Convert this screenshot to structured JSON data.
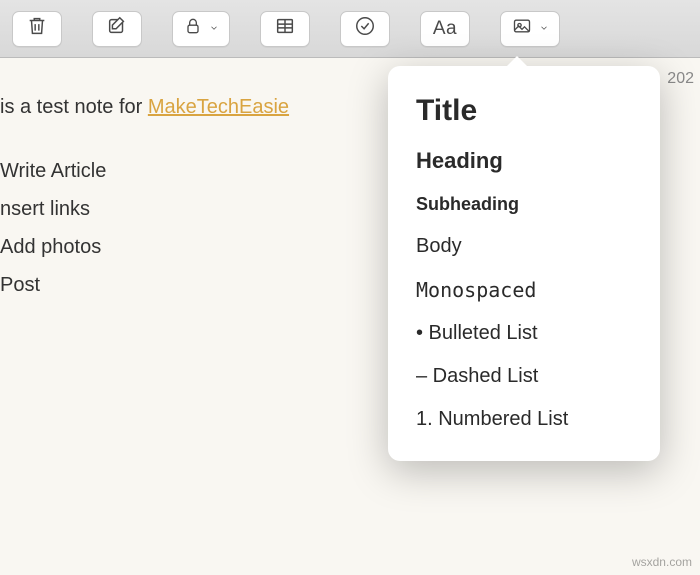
{
  "toolbar": {
    "format_label": "Aa"
  },
  "timestamp": "202",
  "note": {
    "intro_prefix": "is a test note for ",
    "intro_link": "MakeTechEasie",
    "items": [
      "Write Article",
      "nsert links",
      "Add photos",
      "Post"
    ]
  },
  "dropdown": {
    "title": "Title",
    "heading": "Heading",
    "subheading": "Subheading",
    "body": "Body",
    "monospaced": "Monospaced",
    "bulleted": "• Bulleted List",
    "dashed": "– Dashed List",
    "numbered": "1. Numbered List"
  },
  "watermark": "wsxdn.com"
}
